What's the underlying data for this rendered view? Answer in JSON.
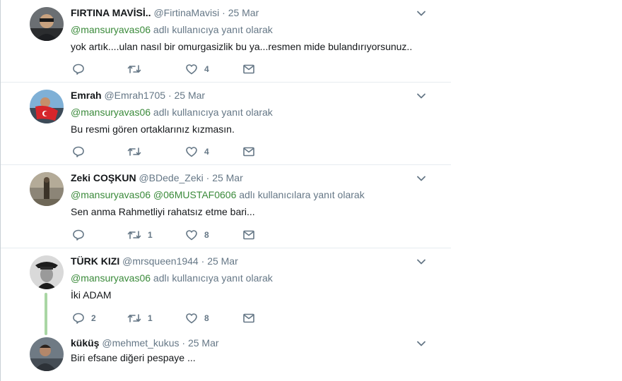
{
  "tweets": [
    {
      "fullname": "FIRTINA MAVİSİ..",
      "username": "@FirtinaMavisi",
      "sep": " · ",
      "time": "25 Mar",
      "reply_mention": "@mansuryavas06",
      "reply_suffix": " adlı kullanıcıya yanıt olarak",
      "text": "yok artık....ulan nasıl bir omurgasizlik bu ya...resmen mide bulandırıyorsunuz..",
      "replies": "",
      "retweets": "",
      "likes": "4"
    },
    {
      "fullname": "Emrah",
      "username": "@Emrah1705",
      "sep": " · ",
      "time": "25 Mar",
      "reply_mention": "@mansuryavas06",
      "reply_suffix": " adlı kullanıcıya yanıt olarak",
      "text": "Bu resmi gören ortaklarınız kızmasın.",
      "replies": "",
      "retweets": "",
      "likes": "4"
    },
    {
      "fullname": "Zeki COŞKUN",
      "username": "@BDede_Zeki",
      "sep": " · ",
      "time": "25 Mar",
      "reply_mention": "@mansuryavas06 @06MUSTAF0606",
      "reply_suffix": " adlı kullanıcılara yanıt olarak",
      "text": "Sen anma Rahmetliyi rahatsız etme bari...",
      "replies": "",
      "retweets": "1",
      "likes": "8"
    },
    {
      "fullname": "TÜRK KIZI",
      "username": "@mrsqueen1944",
      "sep": " · ",
      "time": "25 Mar",
      "reply_mention": "@mansuryavas06",
      "reply_suffix": " adlı kullanıcıya yanıt olarak",
      "text": "İki ADAM",
      "replies": "2",
      "retweets": "1",
      "likes": "8"
    },
    {
      "fullname": "küküş",
      "username": "@mehmet_kukus",
      "sep": " · ",
      "time": "25 Mar",
      "text": "Biri efsane diğeri pespaye ..."
    }
  ],
  "colors": {
    "mention": "#3a8a3a",
    "thread_line": "#a9d6a4",
    "muted": "#657786"
  },
  "icons": [
    "reply-icon",
    "retweet-icon",
    "like-icon",
    "direct-message-icon",
    "chevron-down-icon"
  ]
}
